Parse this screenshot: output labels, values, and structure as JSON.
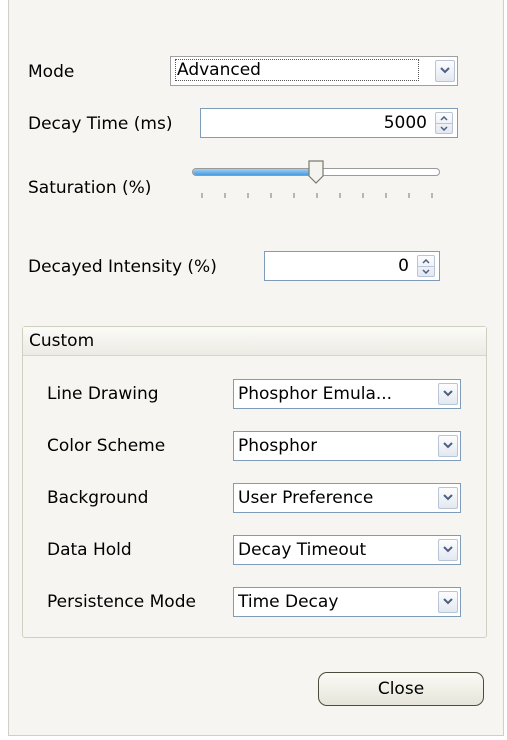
{
  "mode": {
    "label": "Mode",
    "value": "Advanced"
  },
  "decay_time": {
    "label": "Decay Time (ms)",
    "value": "5000"
  },
  "saturation": {
    "label": "Saturation (%)",
    "value_fraction": 0.5
  },
  "decayed_intensity": {
    "label": "Decayed Intensity (%)",
    "value": "0"
  },
  "custom": {
    "title": "Custom",
    "rows": [
      {
        "label": "Line Drawing",
        "value": "Phosphor Emula..."
      },
      {
        "label": "Color Scheme",
        "value": "Phosphor"
      },
      {
        "label": "Background",
        "value": "User Preference"
      },
      {
        "label": "Data Hold",
        "value": "Decay Timeout"
      },
      {
        "label": "Persistence Mode",
        "value": "Time Decay"
      }
    ]
  },
  "close_label": "Close",
  "icons": {
    "dropdown": "chevron-down-icon",
    "spin_up": "arrow-up-icon",
    "spin_down": "arrow-down-icon"
  },
  "colors": {
    "panel_bg": "#f6f5f1",
    "field_border": "#7f9db9",
    "slider_fill": "#4a9de0"
  }
}
